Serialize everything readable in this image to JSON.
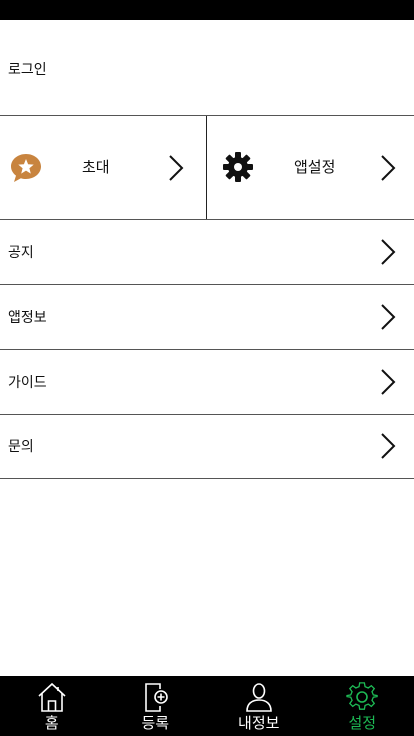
{
  "login": {
    "label": "로그인"
  },
  "quick_actions": [
    {
      "label": "초대",
      "icon": "star-speech-bubble-icon",
      "icon_color": "#c8843f"
    },
    {
      "label": "앱설정",
      "icon": "gear-icon",
      "icon_color": "#111111"
    }
  ],
  "menu_items": [
    {
      "label": "공지"
    },
    {
      "label": "앱정보"
    },
    {
      "label": "가이드"
    },
    {
      "label": "문의"
    }
  ],
  "tab_bar": {
    "tabs": [
      {
        "label": "홈",
        "icon": "home-icon"
      },
      {
        "label": "등록",
        "icon": "add-document-icon"
      },
      {
        "label": "내정보",
        "icon": "user-icon"
      },
      {
        "label": "설정",
        "icon": "gear-icon",
        "active": true
      }
    ],
    "active_color": "#1db954",
    "background": "#000000"
  }
}
